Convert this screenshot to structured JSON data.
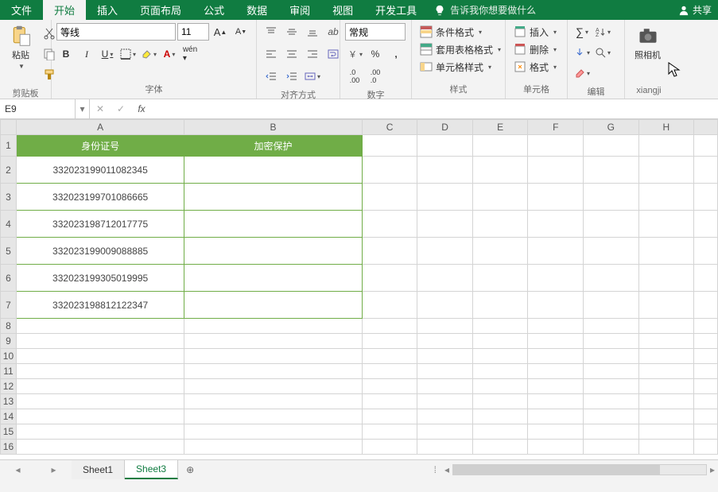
{
  "tabs": {
    "file": "文件",
    "home": "开始",
    "insert": "插入",
    "layout": "页面布局",
    "formula": "公式",
    "data": "数据",
    "review": "审阅",
    "view": "视图",
    "dev": "开发工具"
  },
  "tellme": "告诉我你想要做什么",
  "share": "共享",
  "ribbon": {
    "clipboard": {
      "label": "剪贴板",
      "paste": "粘贴"
    },
    "font": {
      "label": "字体",
      "name": "等线",
      "size": "11"
    },
    "align": {
      "label": "对齐方式"
    },
    "number": {
      "label": "数字",
      "format": "常规"
    },
    "style": {
      "label": "样式",
      "cond": "条件格式",
      "table": "套用表格格式",
      "cell": "单元格样式"
    },
    "cells": {
      "label": "单元格",
      "insert": "插入",
      "delete": "删除",
      "format": "格式"
    },
    "edit": {
      "label": "编辑"
    },
    "camera": {
      "label": "xiangji",
      "btn": "照相机"
    }
  },
  "namebox": "E9",
  "formula": "",
  "cols": [
    "A",
    "B",
    "C",
    "D",
    "E",
    "F",
    "G",
    "H"
  ],
  "header": {
    "a": "身份证号",
    "b": "加密保护"
  },
  "rows": [
    "332023199011082345",
    "332023199701086665",
    "332023198712017775",
    "332023199009088885",
    "332023199305019995",
    "332023198812122347"
  ],
  "sheets": {
    "s1": "Sheet1",
    "s3": "Sheet3"
  }
}
